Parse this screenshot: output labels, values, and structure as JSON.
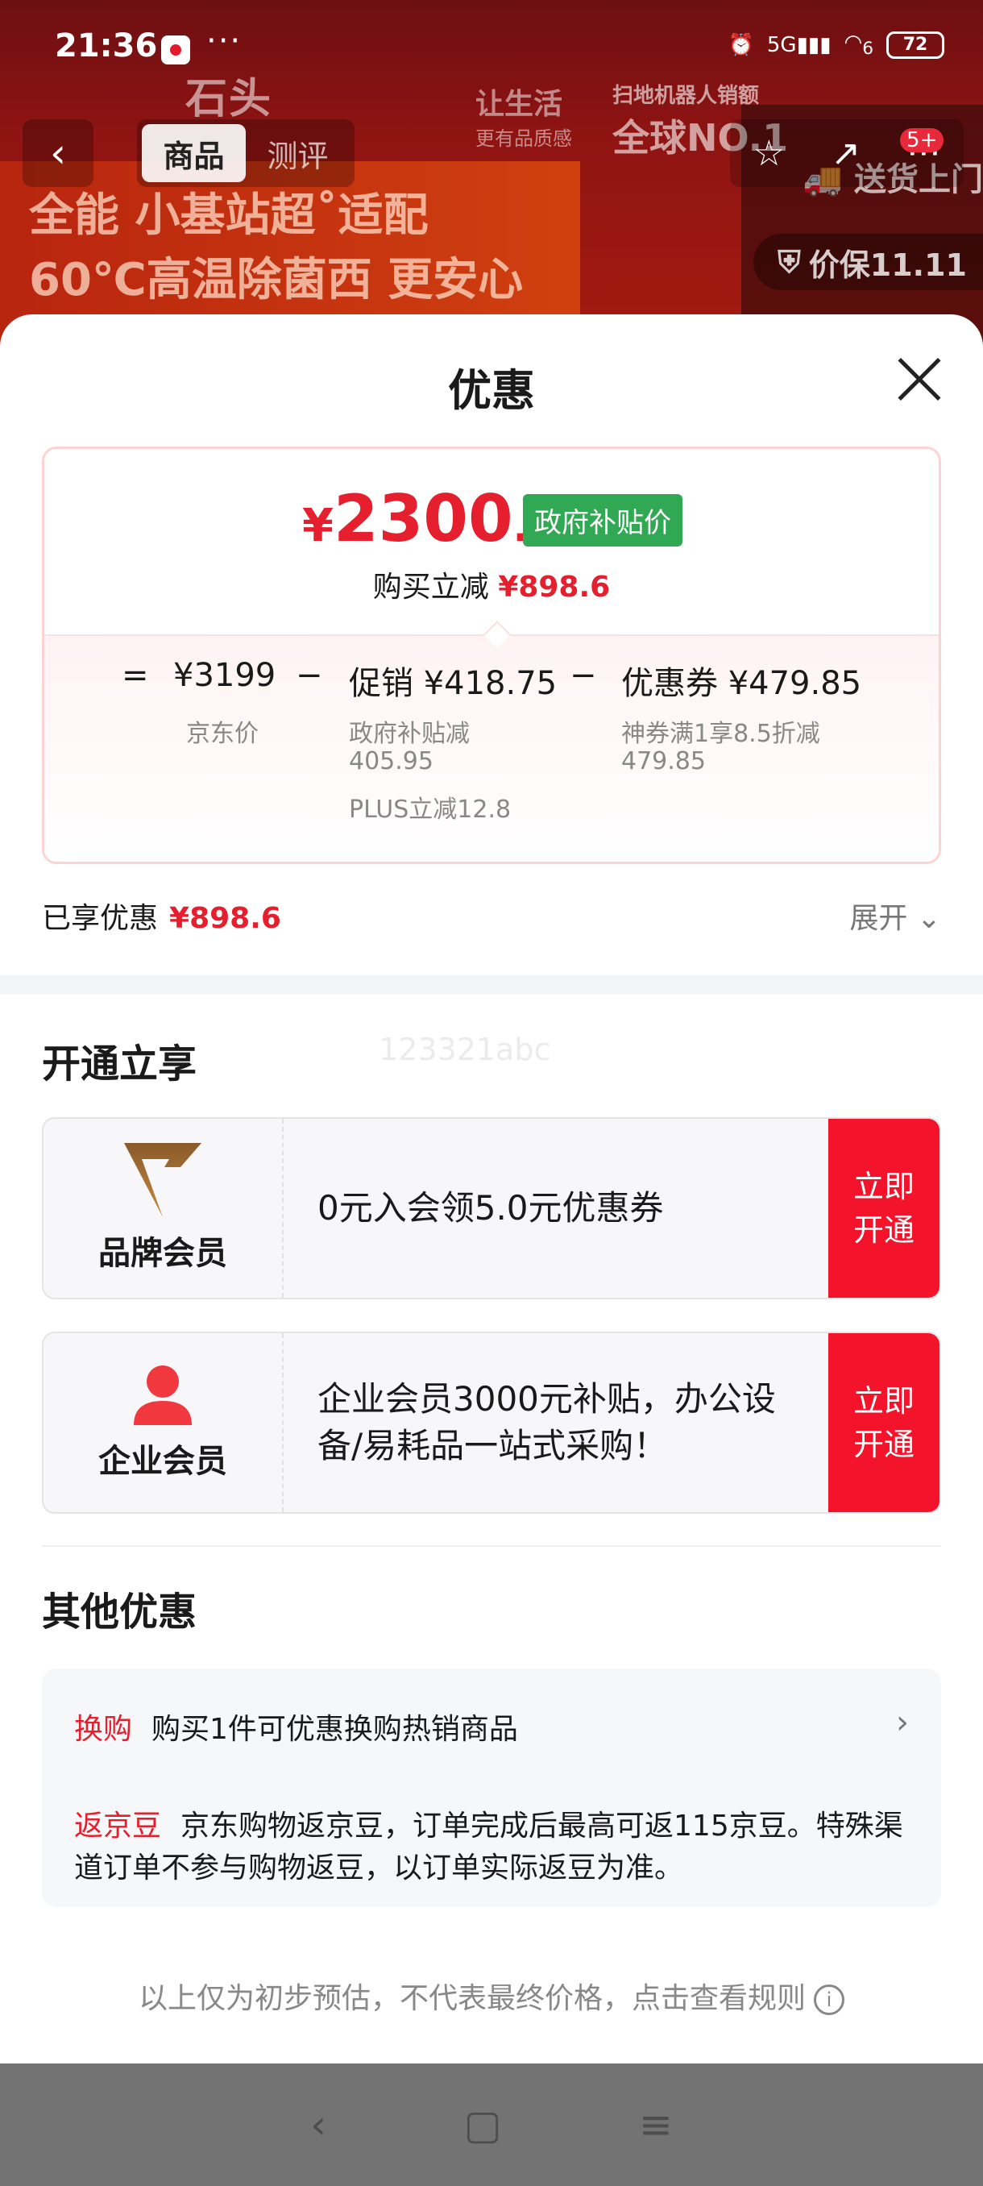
{
  "status": {
    "time": "21:36",
    "dots": "···",
    "network": "5G",
    "wifi_sub": "6",
    "battery": "72"
  },
  "banner": {
    "brand": "石头",
    "slogan_main": "让生活",
    "slogan_sub": "更有品质感",
    "rank_caption": "扫地机器人销额",
    "rank": "全球NO.1",
    "line1": "全能 小基站超˚适配",
    "line2": "60℃高温除菌西 更安心",
    "delivery": "送货上门",
    "price_protect": "价保11.11"
  },
  "header": {
    "tabs": [
      "商品",
      "测评"
    ],
    "badge": "5+"
  },
  "sheet": {
    "title": "优惠",
    "final_price_yen": "¥",
    "final_price_int": "2300",
    "final_price_dec": ".4",
    "gov_tag": "政府补贴价",
    "buy_reduce_label": "购买立减",
    "buy_reduce_value": "¥898.6",
    "calc": {
      "eq": "=",
      "jd_price": "¥3199",
      "jd_label": "京东价",
      "minus1": "−",
      "promo": "促销 ¥418.75",
      "promo_sub1": "政府补贴减",
      "promo_sub1b": "405.95",
      "promo_sub2": "PLUS立减12.8",
      "minus2": "−",
      "coupon": "优惠券 ¥479.85",
      "coupon_sub1": "神券满1享8.5折减",
      "coupon_sub1b": "479.85"
    },
    "enjoyed_label": "已享优惠",
    "enjoyed_value": "¥898.6",
    "expand_label": "展开 ⌄"
  },
  "open_section": {
    "title": "开通立享",
    "watermark": "123321abc",
    "members": [
      {
        "name": "品牌会员",
        "desc": "0元入会领5.0元优惠券",
        "btn_l1": "立即",
        "btn_l2": "开通"
      },
      {
        "name": "企业会员",
        "desc": "企业会员3000元补贴，办公设备/易耗品一站式采购！",
        "btn_l1": "立即",
        "btn_l2": "开通"
      }
    ]
  },
  "other_section": {
    "title": "其他优惠",
    "row1_tag": "换购",
    "row1_text": "购买1件可优惠换购热销商品",
    "row2_tag": "返京豆",
    "row2_text": "京东购物返京豆，订单完成后最高可返115京豆。特殊渠道订单不参与购物返豆，以订单实际返豆为准。"
  },
  "footnote": "以上仅为初步预估，不代表最终价格，点击查看规则",
  "colors": {
    "accent": "#e51f2d",
    "gov_green": "#31a853",
    "button_red": "#f3132a"
  }
}
